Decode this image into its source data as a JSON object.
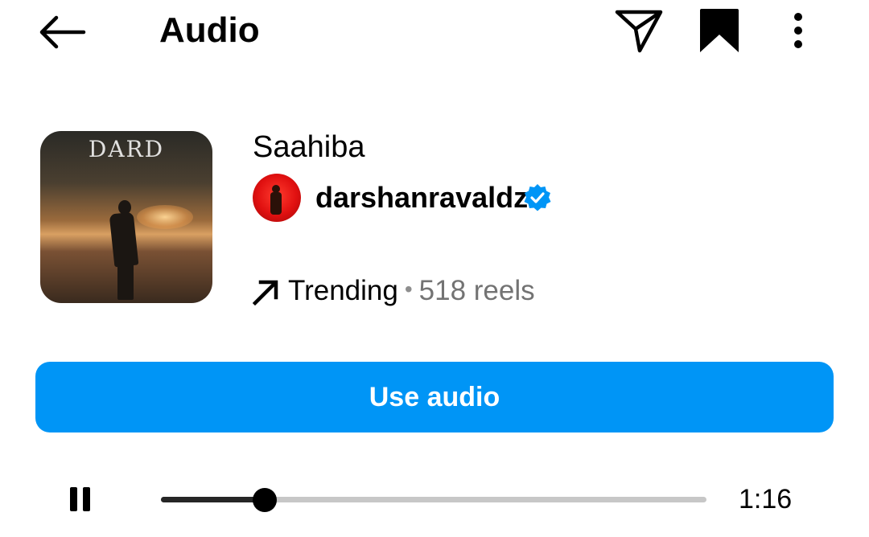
{
  "header": {
    "title": "Audio",
    "back_icon": "arrow-left-icon",
    "share_icon": "paper-plane-icon",
    "save_icon": "bookmark-icon",
    "more_icon": "more-vertical-icon"
  },
  "track": {
    "title": "Saahiba",
    "artist": "darshanravaldz",
    "verified": true,
    "cover_text": "DARD",
    "trend_label": "Trending",
    "separator": "•",
    "reels_count": "518 reels"
  },
  "action": {
    "use_audio_label": "Use audio"
  },
  "player": {
    "state_icon": "pause-icon",
    "progress": 0.19,
    "time": "1:16"
  },
  "colors": {
    "accent": "#0095f6",
    "verified": "#0095f6",
    "muted_text": "#737373",
    "track_bg": "#c7c7c7",
    "track_fill": "#262626"
  }
}
